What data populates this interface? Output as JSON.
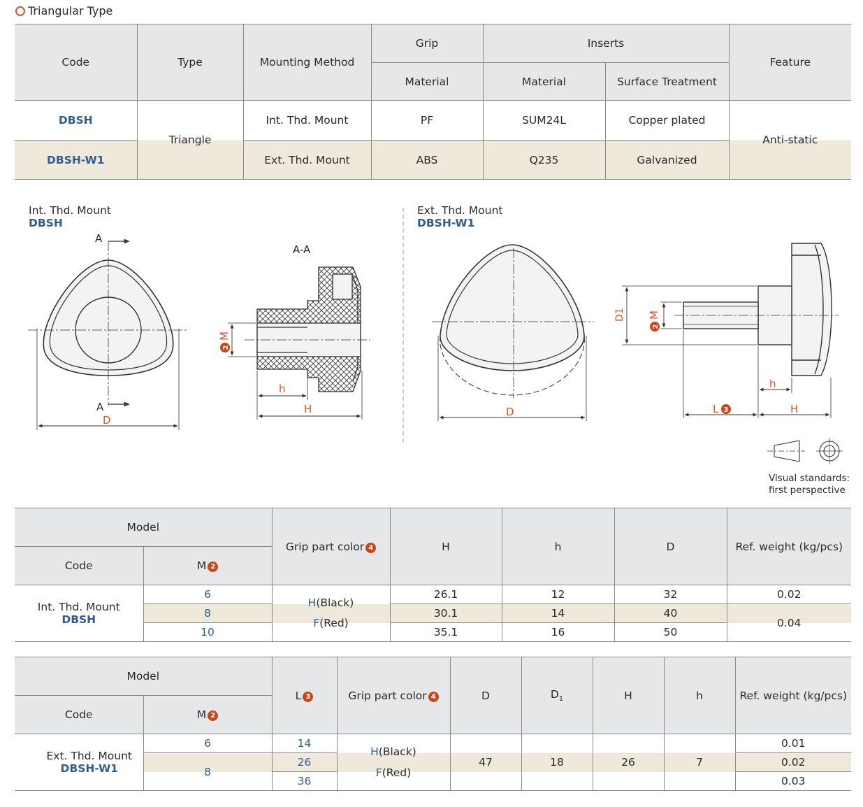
{
  "section_title": "Triangular Type",
  "spec_table": {
    "headers": {
      "code": "Code",
      "type": "Type",
      "mounting": "Mounting Method",
      "grip": "Grip",
      "grip_material": "Material",
      "inserts": "Inserts",
      "inserts_material": "Material",
      "surface": "Surface Treatment",
      "feature": "Feature"
    },
    "rows": [
      {
        "code": "DBSH",
        "mounting": "Int. Thd. Mount",
        "grip_material": "PF",
        "inserts_material": "SUM24L",
        "surface": "Copper plated"
      },
      {
        "code": "DBSH-W1",
        "mounting": "Ext. Thd. Mount",
        "grip_material": "ABS",
        "inserts_material": "Q235",
        "surface": "Galvanized"
      }
    ],
    "type_value": "Triangle",
    "feature_value": "Anti-static"
  },
  "drawings": {
    "left_title": "Int. Thd. Mount",
    "left_code": "DBSH",
    "right_title": "Ext. Thd. Mount",
    "right_code": "DBSH-W1",
    "section_mark": "A",
    "section_view": "A-A",
    "dim_D": "D",
    "dim_h": "h",
    "dim_H": "H",
    "dim_M": "M",
    "dim_D1": "D1",
    "dim_L": "L",
    "badge_2": "2",
    "badge_3": "3",
    "visual_standards": "Visual standards:",
    "first_perspective": "first perspective"
  },
  "table2": {
    "model": "Model",
    "code": "Code",
    "m": "M",
    "m_badge": "2",
    "grip_color": "Grip part color",
    "grip_badge": "4",
    "H": "H",
    "h": "h",
    "D": "D",
    "weight": "Ref. weight (kg/pcs)",
    "code_title": "Int. Thd. Mount",
    "code_value": "DBSH",
    "color_h_letter": "H",
    "color_h_text": "(Black)",
    "color_f_letter": "F",
    "color_f_text": "(Red)",
    "rows": [
      {
        "m": "6",
        "H": "26.1",
        "h": "12",
        "D": "32",
        "weight": "0.02"
      },
      {
        "m": "8",
        "H": "30.1",
        "h": "14",
        "D": "40",
        "weight": ""
      },
      {
        "m": "10",
        "H": "35.1",
        "h": "16",
        "D": "50",
        "weight": ""
      }
    ],
    "shared_weight": "0.04"
  },
  "table3": {
    "model": "Model",
    "code": "Code",
    "m": "M",
    "m_badge": "2",
    "L": "L",
    "L_badge": "3",
    "grip_color": "Grip part color",
    "grip_badge": "4",
    "D": "D",
    "D1": "D",
    "D1_sub": "1",
    "H": "H",
    "h": "h",
    "weight": "Ref. weight (kg/pcs)",
    "code_title": "Ext. Thd. Mount",
    "code_value": "DBSH-W1",
    "m6": "6",
    "m8": "8",
    "L_values": [
      "14",
      "26",
      "36"
    ],
    "color_h_letter": "H",
    "color_h_text": "(Black)",
    "color_f_letter": "F",
    "color_f_text": "(Red)",
    "D_value": "47",
    "D1_value": "18",
    "H_value": "26",
    "h_value": "7",
    "weights": [
      "0.01",
      "0.02",
      "0.03"
    ]
  },
  "colors": {
    "accent": "#d9561d",
    "code_blue": "#2f5d8e",
    "header_gray": "#e6e7e9",
    "highlight": "#efe9dc"
  }
}
